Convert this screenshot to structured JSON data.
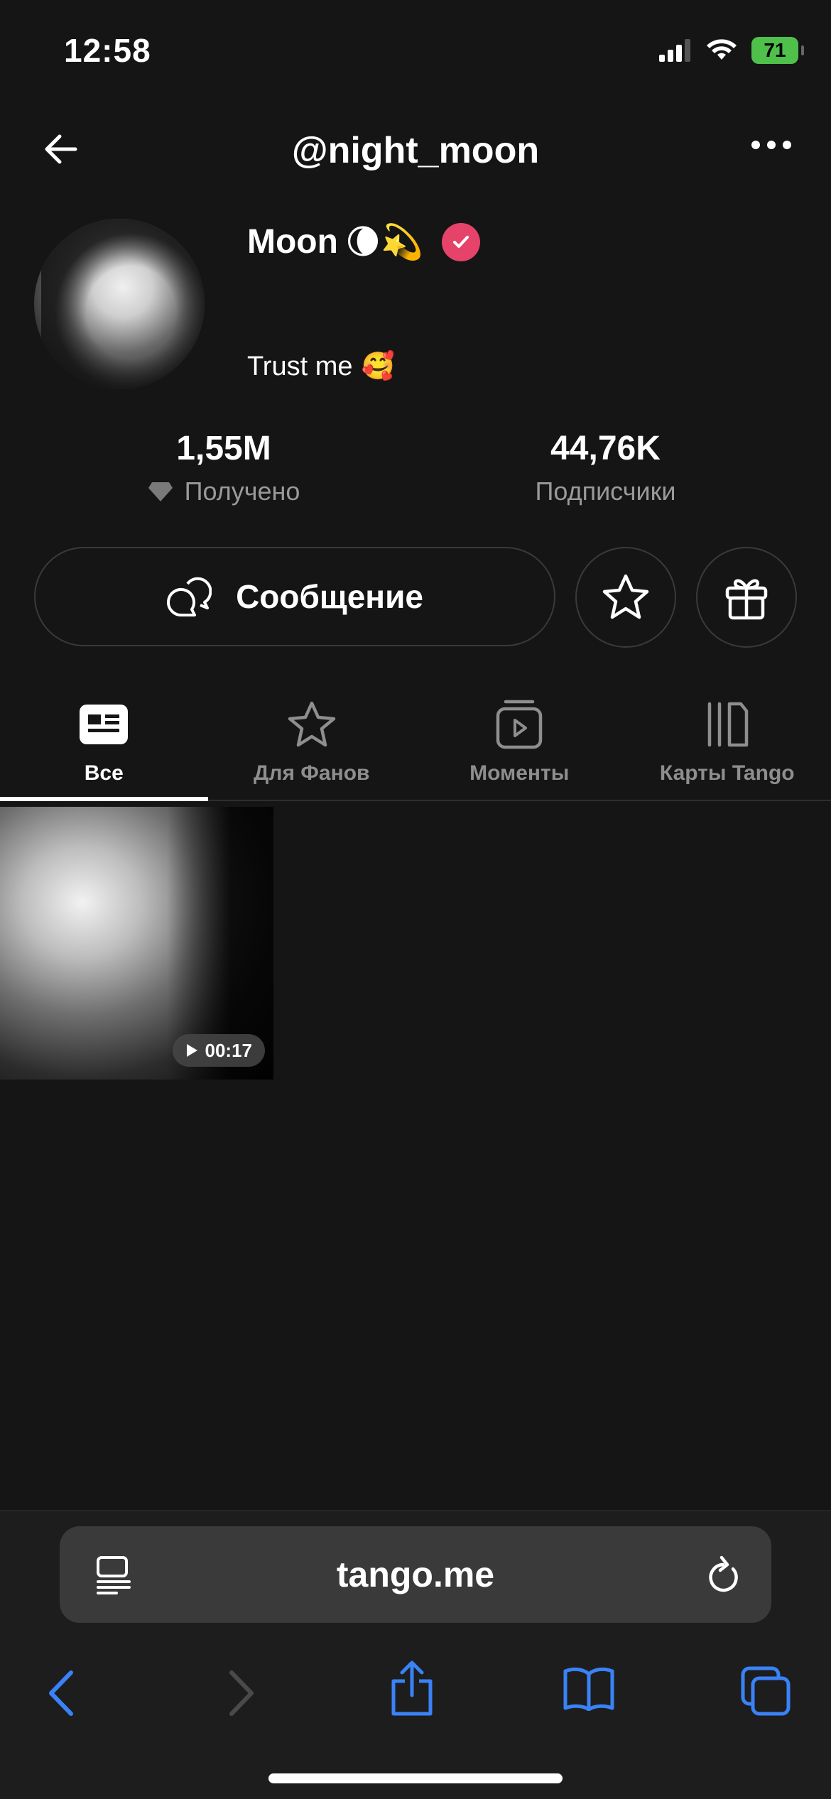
{
  "status_bar": {
    "time": "12:58",
    "battery": "71"
  },
  "header": {
    "handle": "@night_moon"
  },
  "profile": {
    "name": "Moon",
    "name_emojis": "🌘💫",
    "bio": "Trust me",
    "bio_emoji": "🥰"
  },
  "stats": [
    {
      "value": "1,55M",
      "label": "Получено"
    },
    {
      "value": "44,76K",
      "label": "Подписчики"
    }
  ],
  "actions": {
    "message_label": "Сообщение"
  },
  "tabs": [
    {
      "label": "Все",
      "active": true
    },
    {
      "label": "Для Фанов",
      "active": false
    },
    {
      "label": "Моменты",
      "active": false
    },
    {
      "label": "Карты Tango",
      "active": false
    }
  ],
  "posts": [
    {
      "duration": "00:17"
    }
  ],
  "browser": {
    "url": "tango.me"
  },
  "colors": {
    "verified": "#e6436a",
    "safari_blue": "#3a82f7",
    "battery": "#4fc04a"
  }
}
